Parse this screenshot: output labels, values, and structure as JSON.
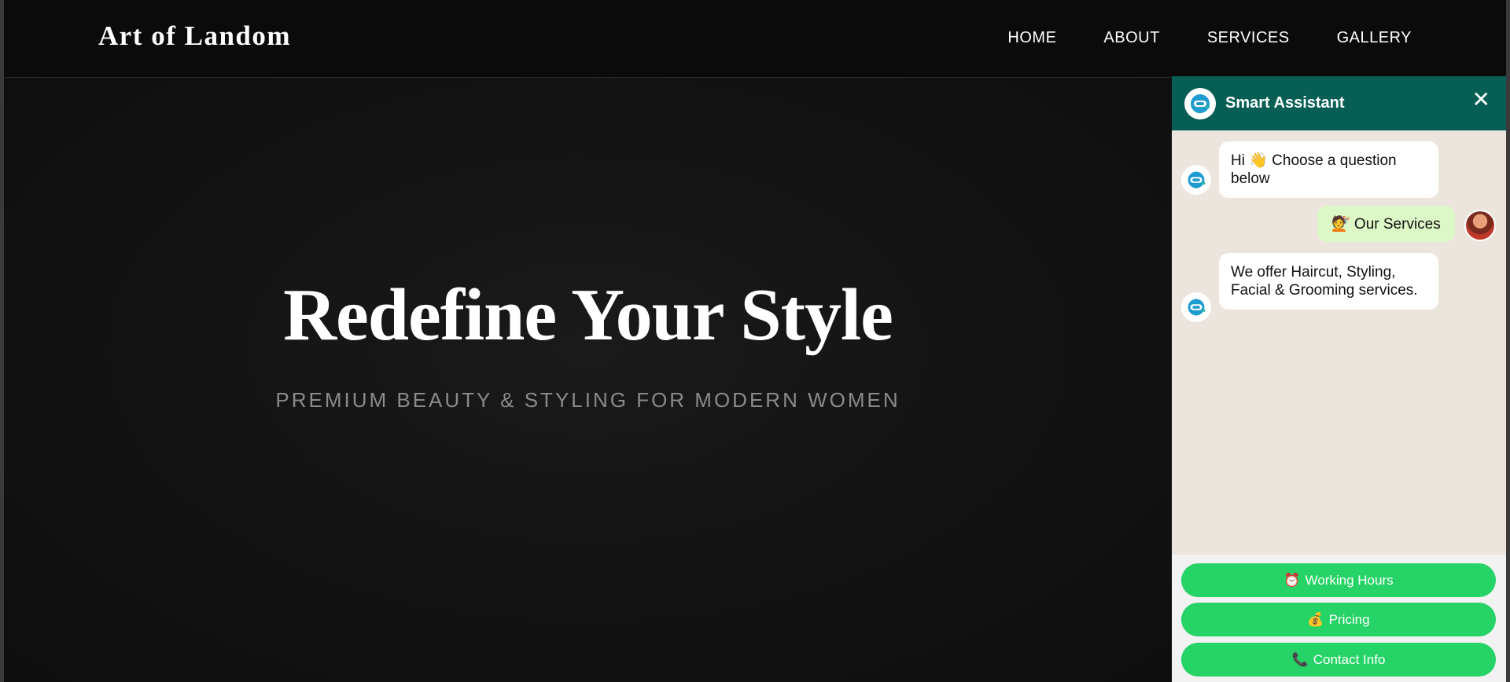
{
  "site": {
    "logo": "Art of Landom",
    "nav": [
      "HOME",
      "ABOUT",
      "SERVICES",
      "GALLERY"
    ]
  },
  "hero": {
    "title": "Redefine Your Style",
    "subtitle": "PREMIUM BEAUTY & STYLING FOR MODERN WOMEN"
  },
  "chat": {
    "title": "Smart Assistant",
    "close": "✕",
    "messages": [
      {
        "from": "bot",
        "text": "Hi 👋 Choose a question below"
      },
      {
        "from": "user",
        "text": "💇 Our Services"
      },
      {
        "from": "bot",
        "text": "We offer Haircut, Styling, Facial & Grooming services."
      }
    ],
    "quick_replies": [
      {
        "icon": "⏰",
        "label": "Working Hours"
      },
      {
        "icon": "💰",
        "label": "Pricing"
      },
      {
        "icon": "📞",
        "label": "Contact Info"
      }
    ],
    "colors": {
      "header": "#075e54",
      "background": "#ece5dd",
      "user_bubble": "#dcf8c6",
      "button": "#25d366"
    }
  }
}
